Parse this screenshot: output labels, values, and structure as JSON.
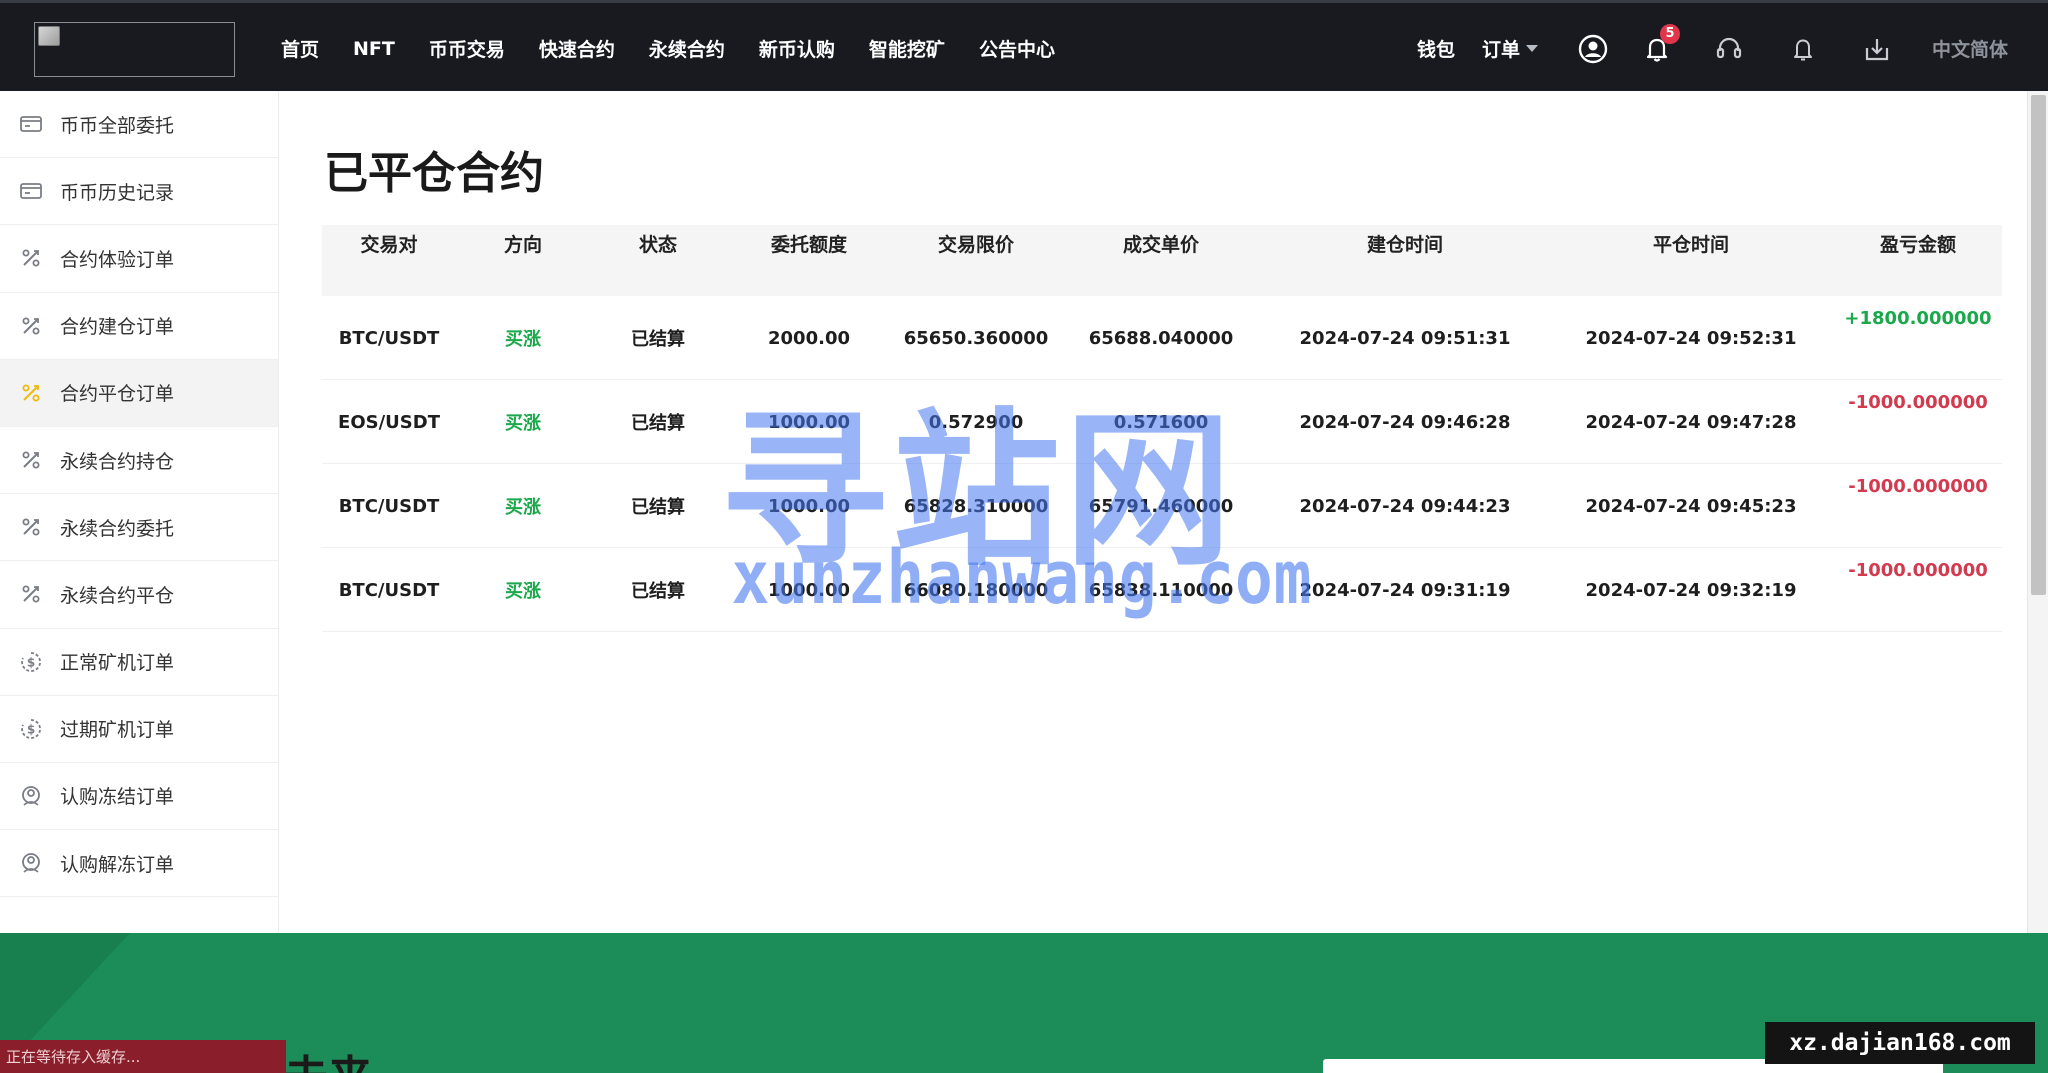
{
  "header": {
    "nav": [
      "首页",
      "NFT",
      "币币交易",
      "快速合约",
      "永续合约",
      "新币认购",
      "智能挖矿",
      "公告中心"
    ],
    "wallet_label": "钱包",
    "orders_label": "订单",
    "notification_count": "5",
    "language": "中文简体"
  },
  "sidebar": {
    "items": [
      {
        "label": "币币全部委托",
        "icon": "wallet-icon"
      },
      {
        "label": "币币历史记录",
        "icon": "wallet-icon"
      },
      {
        "label": "合约体验订单",
        "icon": "percent-icon"
      },
      {
        "label": "合约建仓订单",
        "icon": "percent-icon"
      },
      {
        "label": "合约平仓订单",
        "icon": "percent-icon"
      },
      {
        "label": "永续合约持仓",
        "icon": "percent-icon"
      },
      {
        "label": "永续合约委托",
        "icon": "percent-icon"
      },
      {
        "label": "永续合约平仓",
        "icon": "percent-icon"
      },
      {
        "label": "正常矿机订单",
        "icon": "coin-icon"
      },
      {
        "label": "过期矿机订单",
        "icon": "coin-icon"
      },
      {
        "label": "认购冻结订单",
        "icon": "user-coin-icon"
      },
      {
        "label": "认购解冻订单",
        "icon": "user-coin-icon"
      }
    ],
    "active_index": 4
  },
  "main": {
    "title": "已平仓合约",
    "columns": [
      "交易对",
      "方向",
      "状态",
      "委托额度",
      "交易限价",
      "成交单价",
      "建仓时间",
      "平仓时间",
      "盈亏金额"
    ],
    "rows": [
      {
        "pair": "BTC/USDT",
        "direction": "买涨",
        "status": "已结算",
        "amount": "2000.00",
        "limit_price": "65650.360000",
        "deal_price": "65688.040000",
        "open_time": "2024-07-24 09:51:31",
        "close_time": "2024-07-24 09:52:31",
        "pnl": "+1800.000000",
        "pnl_sign": "pos"
      },
      {
        "pair": "EOS/USDT",
        "direction": "买涨",
        "status": "已结算",
        "amount": "1000.00",
        "limit_price": "0.572900",
        "deal_price": "0.571600",
        "open_time": "2024-07-24 09:46:28",
        "close_time": "2024-07-24 09:47:28",
        "pnl": "-1000.000000",
        "pnl_sign": "neg"
      },
      {
        "pair": "BTC/USDT",
        "direction": "买涨",
        "status": "已结算",
        "amount": "1000.00",
        "limit_price": "65828.310000",
        "deal_price": "65791.460000",
        "open_time": "2024-07-24 09:44:23",
        "close_time": "2024-07-24 09:45:23",
        "pnl": "-1000.000000",
        "pnl_sign": "neg"
      },
      {
        "pair": "BTC/USDT",
        "direction": "买涨",
        "status": "已结算",
        "amount": "1000.00",
        "limit_price": "66080.180000",
        "deal_price": "65838.110000",
        "open_time": "2024-07-24 09:31:19",
        "close_time": "2024-07-24 09:32:19",
        "pnl": "-1000.000000",
        "pnl_sign": "neg"
      }
    ]
  },
  "watermark": {
    "title": "寻站网",
    "domain": "xunzhanwang.com"
  },
  "footer": {
    "heading": "未来",
    "status_text": "正在等待存入缓存...",
    "site_tag": "xz.dajian168.com"
  },
  "colors": {
    "nav_bg": "#181a20",
    "buy_green": "#1ba84a",
    "loss_red": "#d23a4f",
    "footer_green": "#1c8d58",
    "active_icon": "#f0b90b"
  }
}
